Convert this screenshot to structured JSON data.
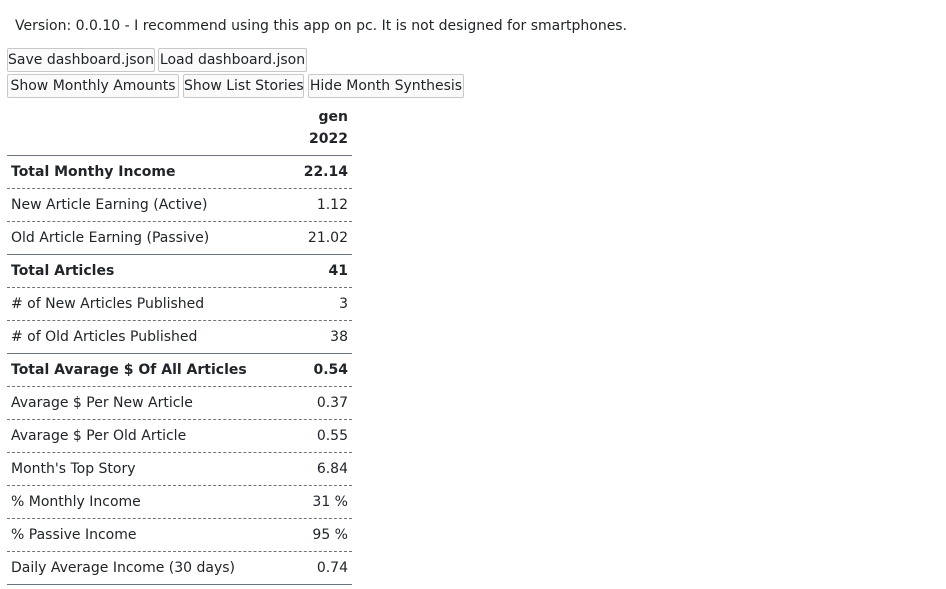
{
  "version_text": "Version: 0.0.10 - I recommend using this app on pc. It is not designed for smartphones.",
  "toolbar": {
    "save": "Save dashboard.json",
    "load": "Load dashboard.json",
    "show_monthly_amounts": "Show Monthly Amounts",
    "show_list_stories": "Show List Stories",
    "hide_month_synthesis": "Hide Month Synthesis"
  },
  "table": {
    "month": "gen",
    "year": "2022",
    "rows": [
      {
        "label": "Total Monthy Income",
        "value": "22.14"
      },
      {
        "label": "New Article Earning (Active)",
        "value": "1.12"
      },
      {
        "label": "Old Article Earning (Passive)",
        "value": "21.02"
      },
      {
        "label": "Total Articles",
        "value": "41"
      },
      {
        "label": "# of New Articles Published",
        "value": "3"
      },
      {
        "label": "# of Old Articles Published",
        "value": "38"
      },
      {
        "label": "Total Avarage $ Of All Articles",
        "value": "0.54"
      },
      {
        "label": "Avarage $ Per New Article",
        "value": "0.37"
      },
      {
        "label": "Avarage $ Per Old Article",
        "value": "0.55"
      },
      {
        "label": "Month's Top Story",
        "value": "6.84"
      },
      {
        "label": "% Monthly Income",
        "value": "31 %"
      },
      {
        "label": "% Passive Income",
        "value": "95 %"
      },
      {
        "label": "Daily Average Income (30 days)",
        "value": "0.74"
      }
    ]
  }
}
